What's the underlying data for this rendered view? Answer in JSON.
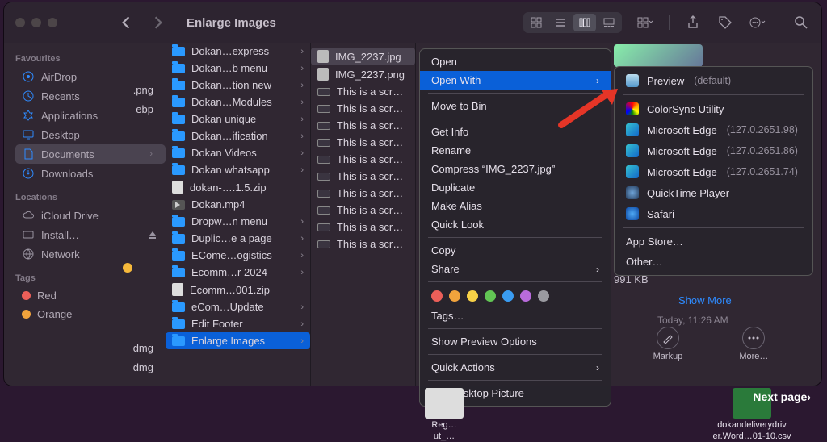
{
  "window": {
    "title": "Enlarge Images"
  },
  "sidebar": {
    "sections": [
      {
        "title": "Favourites",
        "items": [
          {
            "label": "AirDrop",
            "icon": "airdrop-icon"
          },
          {
            "label": "Recents",
            "icon": "clock-icon"
          },
          {
            "label": "Applications",
            "icon": "apps-icon"
          },
          {
            "label": "Desktop",
            "icon": "desktop-icon"
          },
          {
            "label": "Documents",
            "icon": "documents-icon",
            "selected": true
          },
          {
            "label": "Downloads",
            "icon": "downloads-icon"
          }
        ]
      },
      {
        "title": "Locations",
        "items": [
          {
            "label": "iCloud Drive",
            "icon": "cloud-icon"
          },
          {
            "label": "Install…",
            "icon": "disk-icon",
            "eject": true
          },
          {
            "label": "Network",
            "icon": "globe-icon"
          }
        ]
      },
      {
        "title": "Tags",
        "items": [
          {
            "label": "Red",
            "color": "#ec5f59"
          },
          {
            "label": "Orange",
            "color": "#f1a33c"
          }
        ]
      }
    ]
  },
  "columnA": [
    {
      "label": "Dokan…express",
      "type": "folder"
    },
    {
      "label": "Dokan…b menu",
      "type": "folder"
    },
    {
      "label": "Dokan…tion new",
      "type": "folder"
    },
    {
      "label": "Dokan…Modules",
      "type": "folder"
    },
    {
      "label": "Dokan unique",
      "type": "folder"
    },
    {
      "label": "Dokan…ification",
      "type": "folder"
    },
    {
      "label": "Dokan Videos",
      "type": "folder"
    },
    {
      "label": "Dokan whatsapp",
      "type": "folder"
    },
    {
      "label": "dokan-….1.5.zip",
      "type": "zip"
    },
    {
      "label": "Dokan.mp4",
      "type": "mov"
    },
    {
      "label": "Dropw…n menu",
      "type": "folder"
    },
    {
      "label": "Duplic…e a page",
      "type": "folder"
    },
    {
      "label": "ECome…ogistics",
      "type": "folder"
    },
    {
      "label": "Ecomm…r 2024",
      "type": "folder"
    },
    {
      "label": "Ecomm…001.zip",
      "type": "zip"
    },
    {
      "label": "eCom…Update",
      "type": "folder"
    },
    {
      "label": "Edit Footer",
      "type": "folder"
    },
    {
      "label": "Enlarge Images",
      "type": "folder",
      "selected": true
    }
  ],
  "columnB": [
    {
      "label": "IMG_2237.jpg",
      "type": "img",
      "selected": true
    },
    {
      "label": "IMG_2237.png",
      "type": "img"
    },
    {
      "label": "This is a scre…",
      "type": "shot"
    },
    {
      "label": "This is a scre…",
      "type": "shot"
    },
    {
      "label": "This is a scre…",
      "type": "shot"
    },
    {
      "label": "This is a scre…",
      "type": "shot"
    },
    {
      "label": "This is a scre…",
      "type": "shot"
    },
    {
      "label": "This is a scre…",
      "type": "shot"
    },
    {
      "label": "This is a scre…",
      "type": "shot"
    },
    {
      "label": "This is a scre…",
      "type": "shot"
    },
    {
      "label": "This is a scre…",
      "type": "shot"
    },
    {
      "label": "This is a scre…",
      "type": "shot"
    }
  ],
  "preview": {
    "size": "991 KB",
    "show_more": "Show More",
    "timestamp": "Today, 11:26 AM",
    "actions": {
      "markup": "Markup",
      "more": "More…"
    }
  },
  "ctx": {
    "open": "Open",
    "open_with": "Open With",
    "move_to_bin": "Move to Bin",
    "get_info": "Get Info",
    "rename": "Rename",
    "compress": "Compress “IMG_2237.jpg”",
    "duplicate": "Duplicate",
    "make_alias": "Make Alias",
    "quick_look": "Quick Look",
    "copy": "Copy",
    "share": "Share",
    "tags": "Tags…",
    "show_preview_options": "Show Preview Options",
    "quick_actions": "Quick Actions",
    "set_desktop_picture": "Set Desktop Picture",
    "tag_colors": [
      "#ec5f59",
      "#f1a33c",
      "#f7d147",
      "#62c554",
      "#3a9cf2",
      "#b96bdc",
      "#9a9aa0"
    ]
  },
  "openwith": {
    "preview": "Preview",
    "default_suffix": "(default)",
    "colorsync": "ColorSync Utility",
    "edge": "Microsoft Edge",
    "edge_versions": [
      "(127.0.2651.98)",
      "(127.0.2651.86)",
      "(127.0.2651.74)"
    ],
    "quicktime": "QuickTime Player",
    "safari": "Safari",
    "app_store": "App Store…",
    "other": "Other…"
  },
  "clip": {
    "png": ".png",
    "ebp": "ebp",
    "dmg1": "dmg",
    "dmg2": "dmg"
  },
  "desktop": {
    "file1a": "Reg…",
    "file1b": "ut_…",
    "file2a": "dokandeliverydriv",
    "file2b": "er.Word…01-10.csv",
    "next": "Next page›"
  }
}
